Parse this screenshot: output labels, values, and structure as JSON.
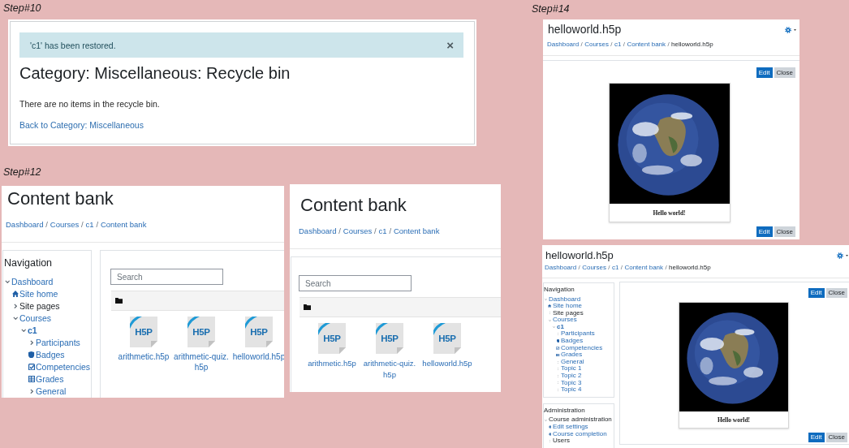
{
  "steps": [
    {
      "label": "Step#10",
      "panels": [
        {
          "kind": "recycle_bin",
          "alert": {
            "message": "'c1' has been restored.",
            "close": "×"
          },
          "title": "Category: Miscellaneous: Recycle bin",
          "message": "There are no items in the recycle bin.",
          "link": "Back to Category: Miscellaneous"
        }
      ]
    },
    {
      "label": "Step#12",
      "panels": [
        {
          "kind": "content_bank",
          "title": "Content bank",
          "breadcrumb": {
            "separator": "/",
            "items": [
              {
                "label": "Dashboard",
                "current": false
              },
              {
                "label": "Courses",
                "current": false
              },
              {
                "label": "c1",
                "current": false
              },
              {
                "label": "Content bank",
                "current": false
              }
            ]
          },
          "blocks": [
            {
              "title": "Navigation",
              "items": [
                {
                  "label": "Dashboard",
                  "kind": "branch",
                  "expanded": true,
                  "children": [
                    {
                      "label": "Site home",
                      "kind": "home"
                    },
                    {
                      "label": "Site pages",
                      "kind": "group",
                      "expanded": false
                    },
                    {
                      "label": "Courses",
                      "kind": "branch",
                      "expanded": true,
                      "children": [
                        {
                          "label": "c1",
                          "kind": "course",
                          "expanded": true,
                          "children": [
                            {
                              "label": "Participants",
                              "kind": "branch",
                              "expanded": false
                            },
                            {
                              "label": "Badges",
                              "kind": "badges"
                            },
                            {
                              "label": "Competencies",
                              "kind": "competencies"
                            },
                            {
                              "label": "Grades",
                              "kind": "grades"
                            },
                            {
                              "label": "General",
                              "kind": "branch",
                              "expanded": false
                            }
                          ]
                        }
                      ]
                    }
                  ]
                }
              ]
            }
          ],
          "search": {
            "placeholder": "Search"
          },
          "files": [
            {
              "name": "arithmetic.h5p",
              "logo": "H5P"
            },
            {
              "name": "arithmetic-quiz.h5p",
              "logo": "H5P"
            },
            {
              "name": "helloworld.h5p",
              "logo": "H5P"
            }
          ]
        },
        {
          "kind": "content_bank",
          "title": "Content bank",
          "breadcrumb": {
            "separator": "/",
            "items": [
              {
                "label": "Dashboard",
                "current": false
              },
              {
                "label": "Courses",
                "current": false
              },
              {
                "label": "c1",
                "current": false
              },
              {
                "label": "Content bank",
                "current": false
              }
            ]
          },
          "search": {
            "placeholder": "Search"
          },
          "files": [
            {
              "name": "arithmetic.h5p",
              "logo": "H5P"
            },
            {
              "name": "arithmetic-quiz.h5p",
              "logo": "H5P"
            },
            {
              "name": "helloworld.h5p",
              "logo": "H5P"
            }
          ]
        }
      ]
    },
    {
      "label": "Step#14",
      "panels": [
        {
          "kind": "content_view",
          "title": "helloworld.h5p",
          "breadcrumb": {
            "separator": "/",
            "items": [
              {
                "label": "Dashboard",
                "current": false
              },
              {
                "label": "Courses",
                "current": false
              },
              {
                "label": "c1",
                "current": false
              },
              {
                "label": "Content bank",
                "current": false
              },
              {
                "label": "helloworld.h5p",
                "current": true
              }
            ]
          },
          "top_buttons": [
            {
              "label": "Edit",
              "kind": "edit"
            },
            {
              "label": "Close",
              "kind": "close"
            }
          ],
          "caption": "Hello world!",
          "bottom_buttons": [
            {
              "label": "Edit",
              "kind": "edit"
            },
            {
              "label": "Close",
              "kind": "close"
            }
          ]
        },
        {
          "kind": "content_view",
          "title": "helloworld.h5p",
          "breadcrumb": {
            "separator": "/",
            "items": [
              {
                "label": "Dashboard",
                "current": false
              },
              {
                "label": "Courses",
                "current": false
              },
              {
                "label": "c1",
                "current": false
              },
              {
                "label": "Content bank",
                "current": false
              },
              {
                "label": "helloworld.h5p",
                "current": true
              }
            ]
          },
          "blocks": [
            {
              "title": "Navigation",
              "items": [
                {
                  "label": "Dashboard",
                  "kind": "branch",
                  "expanded": true,
                  "children": [
                    {
                      "label": "Site home",
                      "kind": "home"
                    },
                    {
                      "label": "Site pages",
                      "kind": "group",
                      "expanded": false
                    },
                    {
                      "label": "Courses",
                      "kind": "branch",
                      "expanded": true,
                      "children": [
                        {
                          "label": "c1",
                          "kind": "course",
                          "expanded": true,
                          "children": [
                            {
                              "label": "Participants",
                              "kind": "branch",
                              "expanded": false
                            },
                            {
                              "label": "Badges",
                              "kind": "badges"
                            },
                            {
                              "label": "Competencies",
                              "kind": "competencies"
                            },
                            {
                              "label": "Grades",
                              "kind": "grades"
                            },
                            {
                              "label": "General",
                              "kind": "branch",
                              "expanded": false
                            },
                            {
                              "label": "Topic 1",
                              "kind": "branch",
                              "expanded": false
                            },
                            {
                              "label": "Topic 2",
                              "kind": "branch",
                              "expanded": false
                            },
                            {
                              "label": "Topic 3",
                              "kind": "branch",
                              "expanded": false
                            },
                            {
                              "label": "Topic 4",
                              "kind": "branch",
                              "expanded": false
                            }
                          ]
                        }
                      ]
                    }
                  ]
                }
              ]
            },
            {
              "title": "Administration",
              "items": [
                {
                  "label": "Course administration",
                  "kind": "group",
                  "expanded": true,
                  "children": [
                    {
                      "label": "Edit settings",
                      "kind": "settings"
                    },
                    {
                      "label": "Course completion",
                      "kind": "settings"
                    },
                    {
                      "label": "Users",
                      "kind": "group",
                      "expanded": false
                    }
                  ]
                }
              ]
            }
          ],
          "top_buttons": [
            {
              "label": "Edit",
              "kind": "edit"
            },
            {
              "label": "Close",
              "kind": "close"
            }
          ],
          "caption": "Hello world!",
          "bottom_buttons": [
            {
              "label": "Edit",
              "kind": "edit"
            },
            {
              "label": "Close",
              "kind": "close"
            }
          ]
        }
      ]
    }
  ]
}
